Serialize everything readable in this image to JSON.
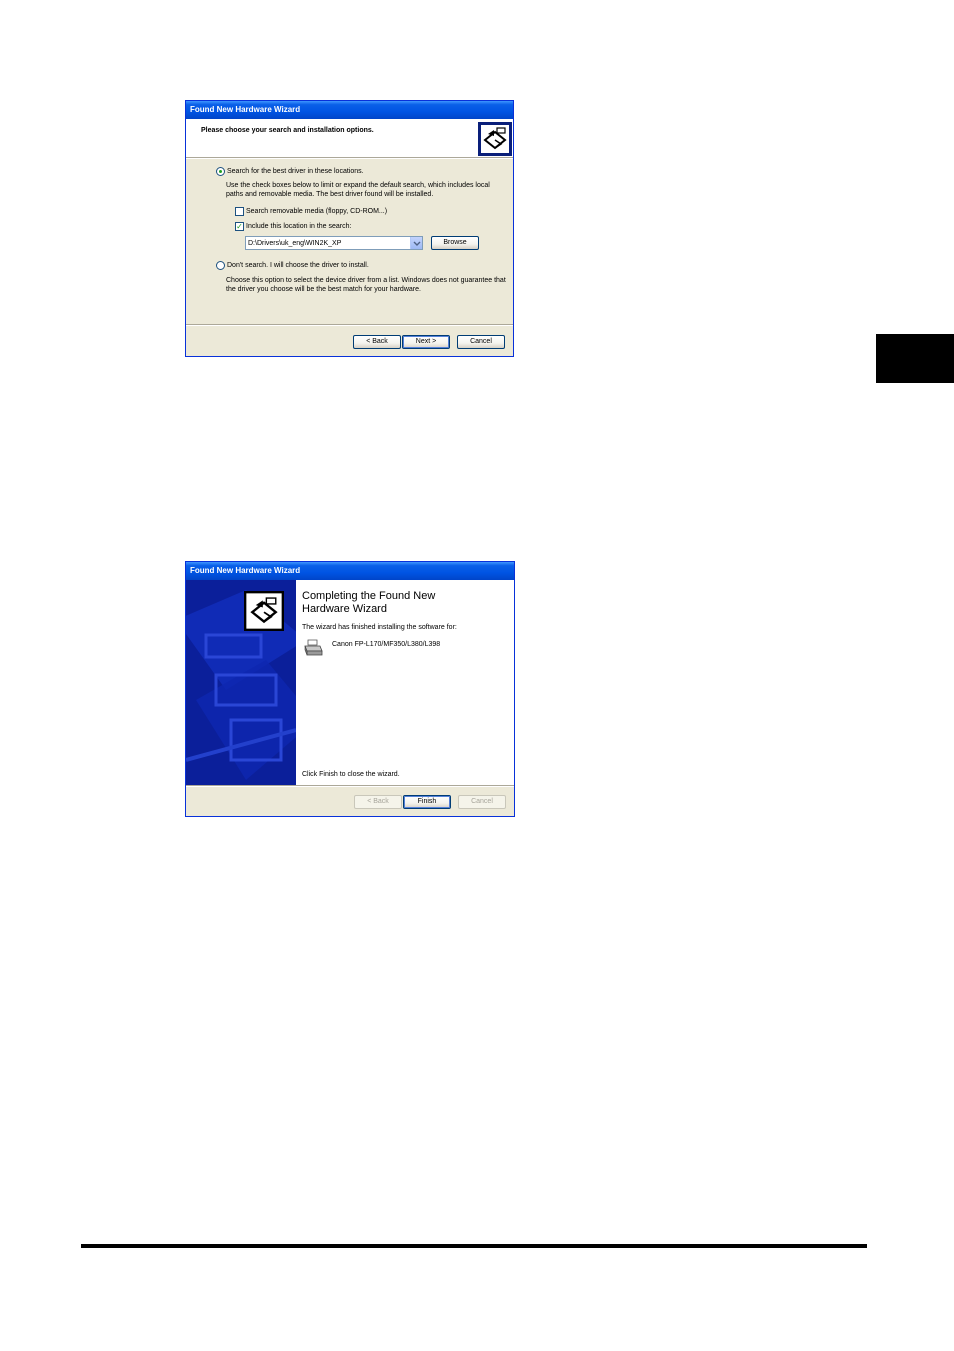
{
  "dialog1": {
    "title": "Found New Hardware Wizard",
    "heading": "Please choose your search and installation options.",
    "radio_search_label": "Search for the best driver in these locations.",
    "search_desc_line1": "Use the check boxes below to limit or expand the default search, which includes local",
    "search_desc_line2": "paths and removable media. The best driver found will be installed.",
    "checkbox_removable_label": "Search removable media (floppy, CD-ROM...)",
    "checkbox_removable_checked": false,
    "checkbox_include_label": "Include this location in the search:",
    "checkbox_include_checked": true,
    "path_value": "D:\\Drivers\\uk_eng\\WIN2K_XP",
    "browse_label": "Browse",
    "radio_dont_search_label": "Don't search. I will choose the driver to install.",
    "dont_desc_line1": "Choose this option to select the device driver from a list. Windows does not guarantee that",
    "dont_desc_line2": "the driver you choose will be the best match for your hardware.",
    "back_label": "< Back",
    "next_label": "Next >",
    "cancel_label": "Cancel",
    "selected_option": "search"
  },
  "dialog2": {
    "title": "Found New Hardware Wizard",
    "heading_line1": "Completing the Found New",
    "heading_line2": "Hardware Wizard",
    "finished_text": "The wizard has finished installing the software for:",
    "device_name": "Canon FP-L170/MF350/L380/L398",
    "close_hint": "Click Finish to close the wizard.",
    "back_label": "< Back",
    "finish_label": "Finish",
    "cancel_label": "Cancel"
  },
  "colors": {
    "title_blue": "#0054e3",
    "dialog_bg": "#ece9d8",
    "banner_blue": "#0a1f9e",
    "page_tab": "#000000"
  }
}
